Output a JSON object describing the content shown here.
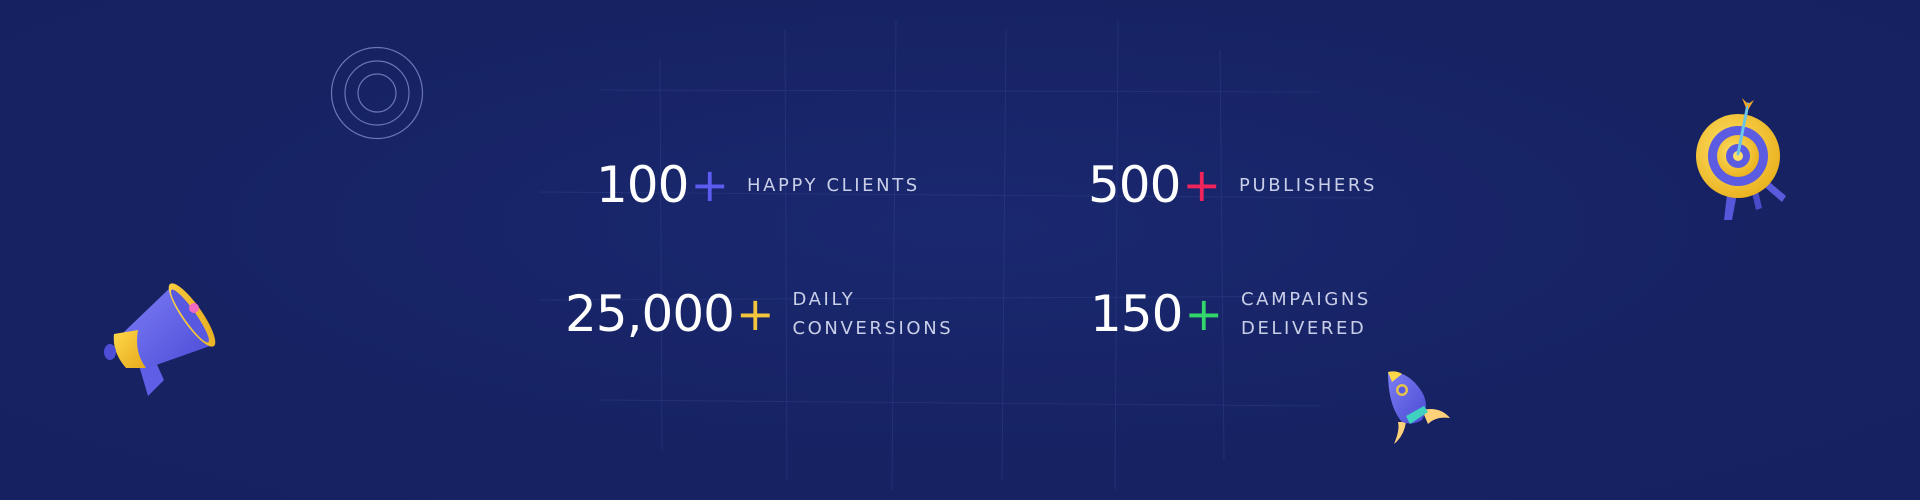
{
  "stats": [
    {
      "value": "100",
      "plus": "+",
      "label": "HAPPY CLIENTS",
      "plus_color": "#5b5cf0"
    },
    {
      "value": "500",
      "plus": "+",
      "label": "PUBLISHERS",
      "plus_color": "#f0245a"
    },
    {
      "value": "25,000",
      "plus": "+",
      "label": "DAILY\nCONVERSIONS",
      "plus_color": "#f2c53d"
    },
    {
      "value": "150",
      "plus": "+",
      "label": "CAMPAIGNS\nDELIVERED",
      "plus_color": "#32d66a"
    }
  ],
  "decorations": {
    "megaphone_icon": "megaphone-icon",
    "target_icon": "target-icon",
    "rocket_icon": "rocket-icon",
    "rings_icon": "concentric-circles-icon"
  },
  "colors": {
    "background": "#162262",
    "text": "#ffffff",
    "label": "#c9cfe8"
  }
}
